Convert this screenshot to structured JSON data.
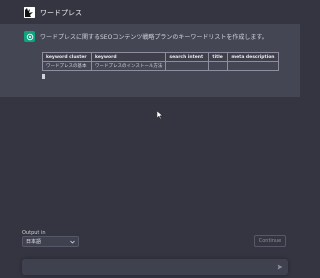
{
  "user_message": {
    "text": "ワードプレス"
  },
  "assistant_message": {
    "intro": "ワードプレスに関するSEOコンテンツ戦略プランのキーワードリストを作成します。",
    "table": {
      "headers": [
        "keyword cluster",
        "keyword",
        "search intent",
        "title",
        "meta description"
      ],
      "rows": [
        [
          "ワードプレスの基本",
          "ワードプレスのインストール方法",
          "",
          "",
          ""
        ]
      ]
    }
  },
  "controls": {
    "output_label": "Output in",
    "language": "日本語",
    "continue_label": "Continue"
  },
  "colors": {
    "background": "#343541",
    "assistant_background": "#444654",
    "accent": "#10a37f"
  }
}
